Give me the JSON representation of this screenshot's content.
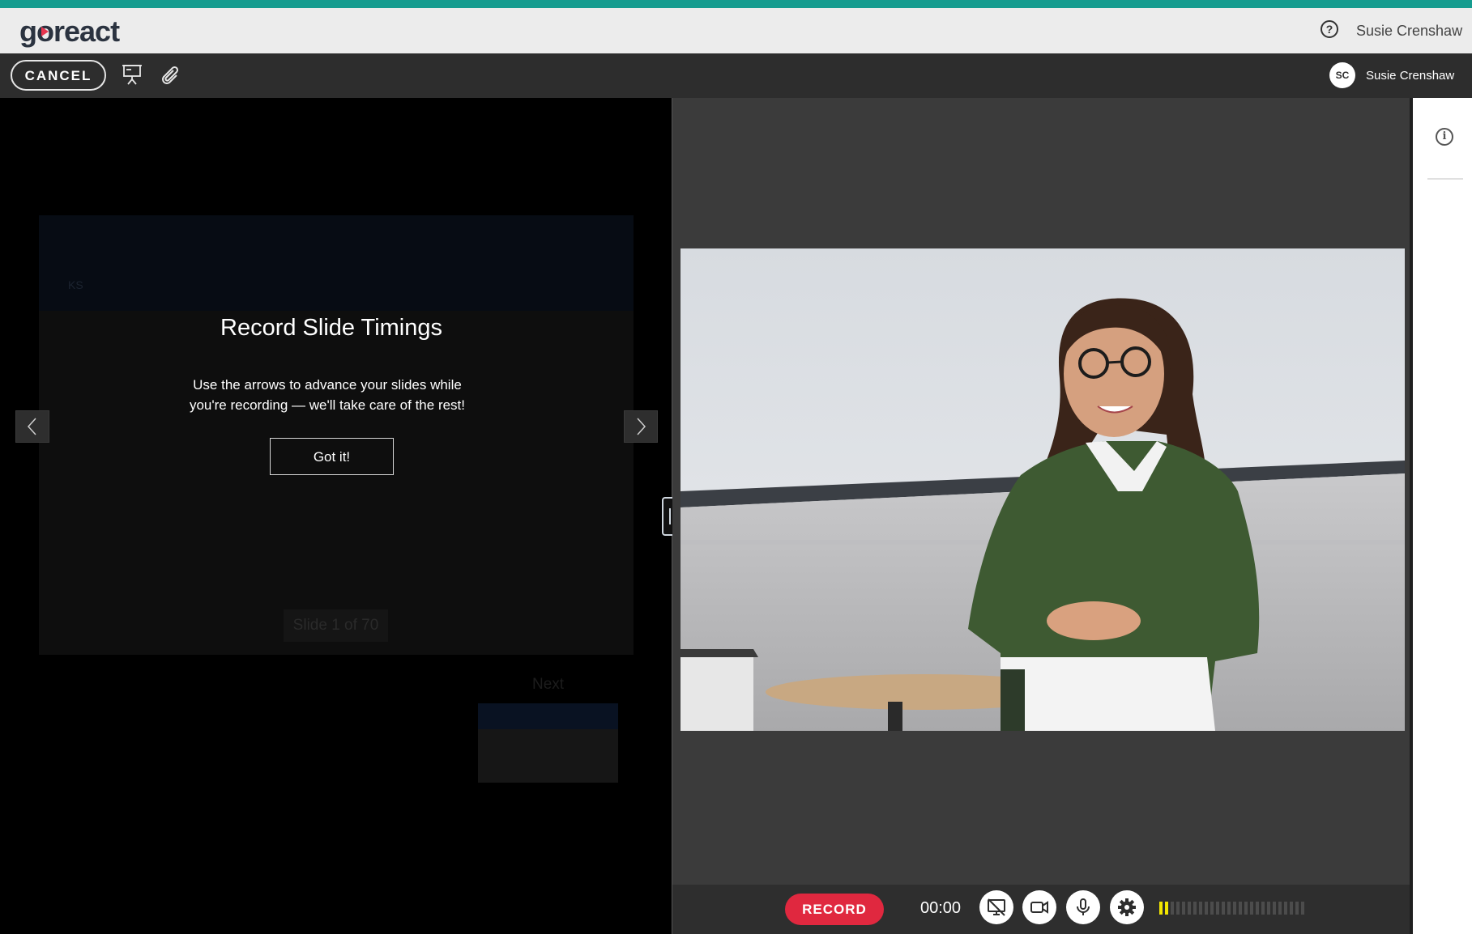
{
  "brand": {
    "logo_text": "goreact",
    "stripe_color": "#159c8f",
    "logo_accent": "#e8364f"
  },
  "header": {
    "help_icon": "question-circle-icon",
    "user_name": "Susie Crenshaw"
  },
  "toolbar": {
    "cancel_label": "CANCEL",
    "slides_icon": "presentation-icon",
    "attach_icon": "paperclip-icon",
    "user_initials": "SC",
    "user_name": "Susie Crenshaw"
  },
  "slides": {
    "counter": "Slide 1 of 70",
    "header_tag": "KS",
    "next_label": "Next",
    "prev_icon": "chevron-left-icon",
    "next_icon": "chevron-right-icon"
  },
  "modal": {
    "title": "Record Slide Timings",
    "body_line1": "Use the arrows to advance your slides while",
    "body_line2": "you're recording — we'll take care of the rest!",
    "button": "Got it!"
  },
  "recorder": {
    "record_label": "RECORD",
    "record_color": "#e0283f",
    "timer": "00:00",
    "screen_share_icon": "screen-share-off-icon",
    "camera_icon": "video-camera-icon",
    "mic_icon": "microphone-icon",
    "settings_icon": "gear-icon",
    "audio_level": 0.08
  },
  "side_panel": {
    "info_icon": "info-icon"
  }
}
